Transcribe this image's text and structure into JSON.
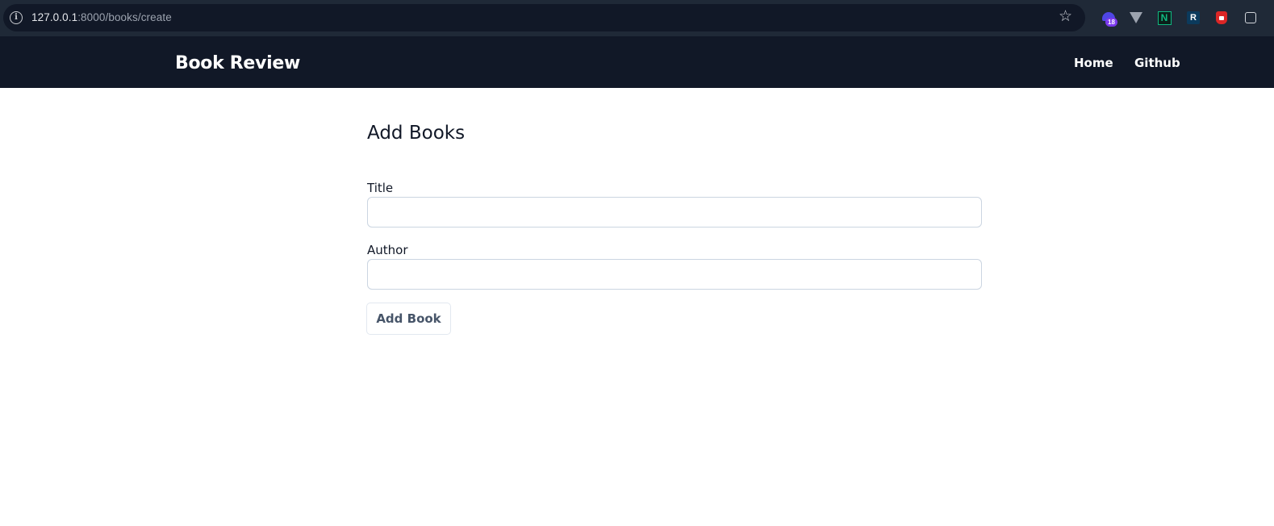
{
  "browser": {
    "url_host": "127.0.0.1",
    "url_path": ":8000/books/create",
    "extensions": {
      "hat_badge": "18",
      "n_letter": "N",
      "r_letter": "R"
    }
  },
  "navbar": {
    "brand": "Book Review",
    "links": [
      {
        "label": "Home"
      },
      {
        "label": "Github"
      }
    ]
  },
  "form": {
    "heading": "Add Books",
    "title_label": "Title",
    "title_value": "",
    "author_label": "Author",
    "author_value": "",
    "submit_label": "Add Book"
  }
}
